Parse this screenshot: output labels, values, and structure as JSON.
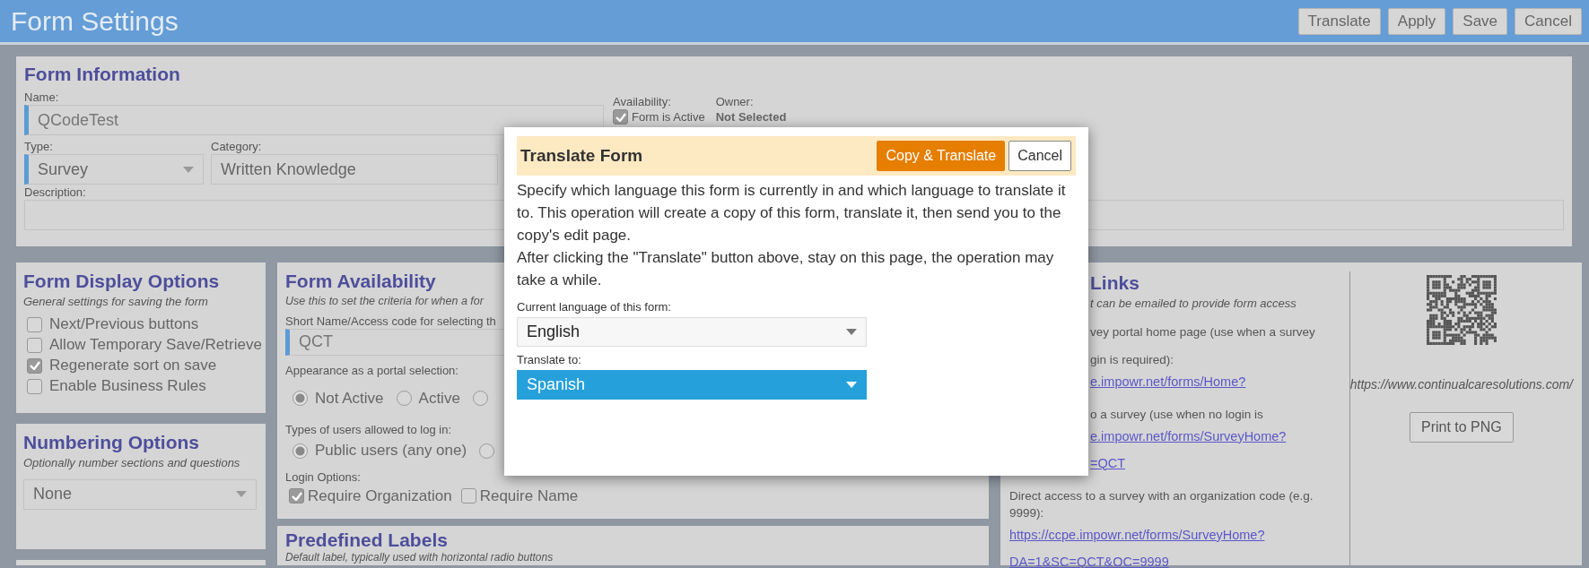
{
  "window": {
    "title": "Form Settings"
  },
  "toolbar_buttons": [
    "Translate",
    "Apply",
    "Save",
    "Cancel"
  ],
  "form_information": {
    "heading": "Form Information",
    "name": {
      "label": "Name:",
      "value": "QCodeTest"
    },
    "availability": {
      "label": "Availability:",
      "option": {
        "label": "Form is Active",
        "checked": true
      }
    },
    "owner": {
      "label": "Owner:",
      "value": "Not Selected"
    },
    "type": {
      "label": "Type:",
      "value": "Survey"
    },
    "category": {
      "label": "Category:",
      "value": "Written Knowledge"
    },
    "description": {
      "label": "Description:"
    }
  },
  "display_options": {
    "heading": "Form Display Options",
    "subtitle": "General settings for saving the form",
    "options": [
      {
        "label": "Next/Previous buttons",
        "checked": false
      },
      {
        "label": "Allow Temporary Save/Retrieve",
        "checked": false
      },
      {
        "label": "Regenerate sort on save",
        "checked": true
      },
      {
        "label": "Enable Business Rules",
        "checked": false
      }
    ]
  },
  "numbering_options": {
    "heading": "Numbering Options",
    "subtitle": "Optionally number sections and questions",
    "value": "None"
  },
  "form_availability": {
    "heading": "Form Availability",
    "subtitle": "Use this to set the criteria for when a for",
    "short_name": {
      "label": "Short Name/Access code for selecting th",
      "value": "QCT"
    },
    "appearance": {
      "label": "Appearance as a portal selection:",
      "options": [
        {
          "label": "Not Active",
          "selected": true
        },
        {
          "label": "Active",
          "selected": false
        },
        {
          "selected": false
        }
      ]
    },
    "user_types": {
      "label": "Types of users allowed to log in:",
      "options": [
        {
          "label": "Public users (any one)",
          "selected": true
        },
        {
          "selected": false
        }
      ]
    },
    "login_options": {
      "label": "Login Options:",
      "options": [
        {
          "label": "Require Organization",
          "checked": true
        },
        {
          "label": "Require Name",
          "checked": false
        }
      ]
    }
  },
  "predefined_labels": {
    "heading": "Predefined Labels",
    "subtitle": "Default label, typically used with horizontal radio buttons"
  },
  "links": {
    "heading": "Links",
    "subtitle": "t can be emailed to provide form access",
    "entries": [
      {
        "kind": "text",
        "text": "vey portal home page (use when a survey"
      },
      {
        "kind": "text",
        "text": "gin is required):"
      },
      {
        "kind": "link",
        "text": "e.impowr.net/forms/Home?"
      },
      {
        "kind": "text",
        "text": "o a survey (use when no login is"
      },
      {
        "kind": "link",
        "text": "e.impowr.net/forms/SurveyHome?"
      },
      {
        "kind": "link",
        "text": "=QCT"
      },
      {
        "kind": "text",
        "text": "Direct access to a survey with an organization code (e.g. 9999):"
      },
      {
        "kind": "link",
        "text": "https://ccpe.impowr.net/forms/SurveyHome?DA=1&SC=QCT&OC=9999"
      }
    ]
  },
  "qr": {
    "url": "https://www.continualcaresolutions.com/",
    "button": "Print to PNG"
  },
  "dialog": {
    "title": "Translate Form",
    "buttons": [
      {
        "kind": "primary",
        "label": "Copy & Translate"
      },
      {
        "kind": "secondary",
        "label": "Cancel"
      }
    ],
    "paragraphs": [
      "Specify which language this form is currently in and which language to translate it to. This operation will create a copy of this form, translate it, then send you to the copy's edit page.",
      "After clicking the \"Translate\" button above, stay on this page, the operation may take a while."
    ],
    "fields": [
      {
        "label": "Current language of this form:",
        "value": "English",
        "focused": false
      },
      {
        "label": "Translate to:",
        "value": "Spanish",
        "focused": true
      }
    ]
  }
}
